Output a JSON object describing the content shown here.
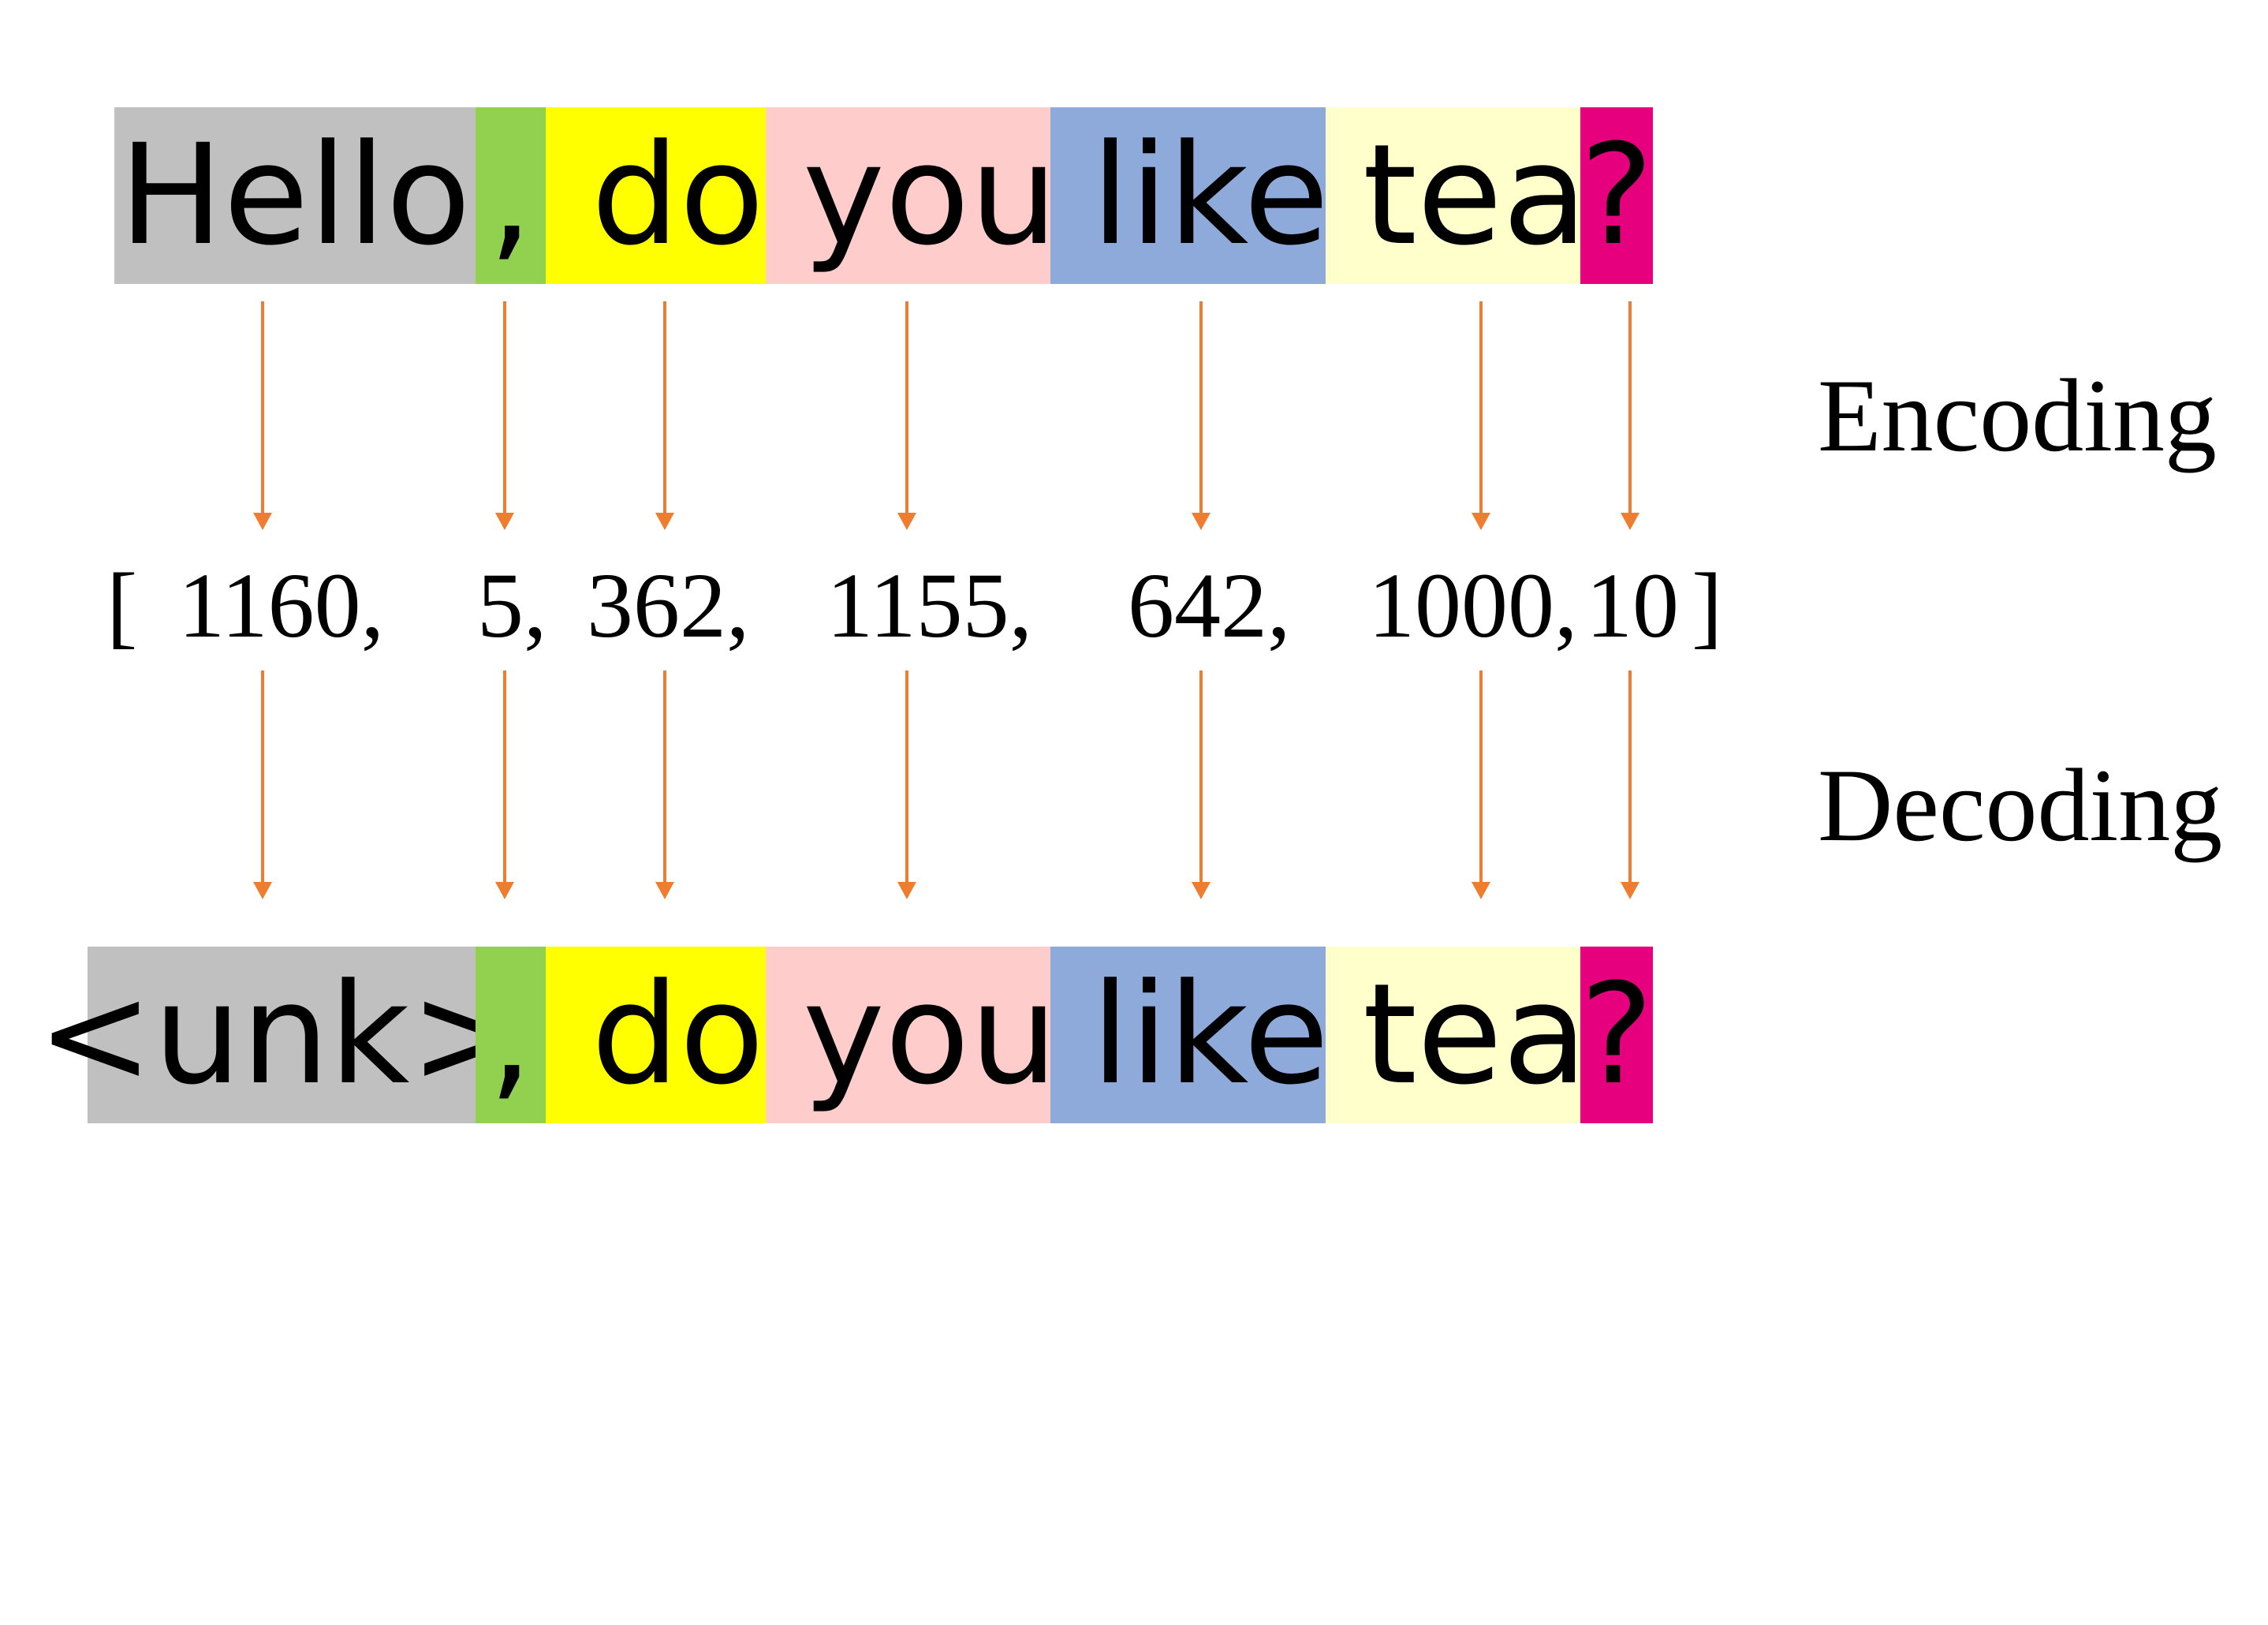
{
  "top_tokens": [
    {
      "text": "Hello",
      "color": "#c0c0c0"
    },
    {
      "text": ",",
      "color": "#92d050"
    },
    {
      "text": " do",
      "color": "#ffff00"
    },
    {
      "text": " you",
      "color": "#ffcccc"
    },
    {
      "text": " like",
      "color": "#8eaadb"
    },
    {
      "text": " tea",
      "color": "#ffffcc"
    },
    {
      "text": "?",
      "color": "#e6007e"
    }
  ],
  "bottom_tokens": [
    {
      "text": "<unk>",
      "color": "#c0c0c0"
    },
    {
      "text": ",",
      "color": "#92d050"
    },
    {
      "text": " do",
      "color": "#ffff00"
    },
    {
      "text": " you",
      "color": "#ffcccc"
    },
    {
      "text": " like",
      "color": "#8eaadb"
    },
    {
      "text": " tea",
      "color": "#ffffcc"
    },
    {
      "text": "?",
      "color": "#e6007e"
    }
  ],
  "token_ids": {
    "open_bracket": "[",
    "close_bracket": "]",
    "values": [
      "1160,",
      "5,",
      "362,",
      "1155,",
      "642,",
      "1000,",
      "10"
    ]
  },
  "labels": {
    "encoding": "Encoding",
    "decoding": "Decoding"
  },
  "arrow_color": "#ed7d31"
}
